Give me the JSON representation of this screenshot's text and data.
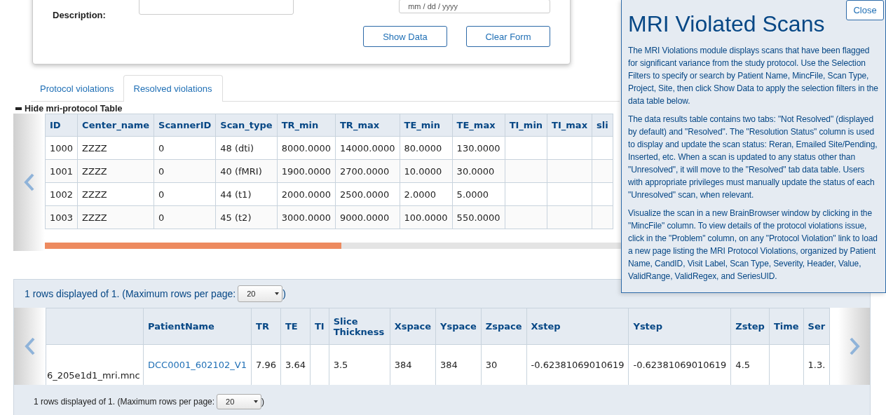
{
  "filter_form": {
    "description_label": "Description:",
    "date_placeholder": "mm / dd / yyyy",
    "buttons": [
      "Show Data",
      "Clear Form"
    ]
  },
  "tabs": [
    {
      "label": "Protocol violations",
      "selected": false
    },
    {
      "label": "Resolved violations",
      "selected": true
    }
  ],
  "protocol_table": {
    "toggle_label": "Hide mri-protocol Table",
    "columns": [
      "ID",
      "Center_name",
      "ScannerID",
      "Scan_type",
      "TR_min",
      "TR_max",
      "TE_min",
      "TE_max",
      "TI_min",
      "TI_max",
      "sli"
    ],
    "rows": [
      [
        "1000",
        "ZZZZ",
        "0",
        "48 (dti)",
        "8000.0000",
        "14000.0000",
        "80.0000",
        "130.0000",
        null,
        null,
        null
      ],
      [
        "1001",
        "ZZZZ",
        "0",
        "40 (fMRI)",
        "1900.0000",
        "2700.0000",
        "10.0000",
        "30.0000",
        null,
        null,
        null
      ],
      [
        "1002",
        "ZZZZ",
        "0",
        "44 (t1)",
        "2000.0000",
        "2500.0000",
        "2.0000",
        "5.0000",
        null,
        null,
        null
      ],
      [
        "1003",
        "ZZZZ",
        "0",
        "45 (t2)",
        "3000.0000",
        "9000.0000",
        "100.0000",
        "550.0000",
        null,
        null,
        null
      ]
    ]
  },
  "results": {
    "summary_text": "1 rows displayed of 1. (Maximum rows per page:",
    "page_size": "20",
    "summary_close": ")",
    "columns": [
      null,
      "PatientName",
      "TR",
      "TE",
      "TI",
      "Slice Thickness",
      "Xspace",
      "Yspace",
      "Zspace",
      "Xstep",
      "Ystep",
      "Zstep",
      "Time",
      "Ser"
    ],
    "rows": [
      [
        {
          "text": "6_205e1d1_mri.mnc",
          "link": false
        },
        {
          "text": "DCC0001_602102_V1",
          "link": true
        },
        {
          "text": "7.96",
          "link": false
        },
        {
          "text": "3.64",
          "link": false
        },
        null,
        {
          "text": "3.5",
          "link": false
        },
        {
          "text": "384",
          "link": false
        },
        {
          "text": "384",
          "link": false
        },
        {
          "text": "30",
          "link": false
        },
        {
          "text": "-0.62381069010619",
          "link": false
        },
        {
          "text": "-0.62381069010619",
          "link": false
        },
        {
          "text": "4.5",
          "link": false
        },
        null,
        {
          "text": "1.3.",
          "link": false
        }
      ]
    ],
    "footer_text": "1 rows displayed of 1. (Maximum rows per page:",
    "footer_page_size": "20",
    "footer_close": ")"
  },
  "help_panel": {
    "title": "MRI Violated Scans",
    "close_label": "Close",
    "paragraphs": [
      "The MRI Violations module displays scans that have been flagged for significant variance from the study protocol. Use the Selection Filters to specify or search by Patient Name, MincFile, Scan Type, Project, Site, then click Show Data to apply the selection filters in the data table below.",
      "The data results table contains two tabs: \"Not Resolved\" (displayed by default) and \"Resolved\". The \"Resolution Status\" column is used to display and update the scan status: Reran, Emailed Site/Pending, Inserted, etc. When a scan is updated to any status other than \"Unresolved\", it will move to the \"Resolved\" tab data table. Users with appropriate privileges must manually update the status of each \"Unresolved\" scan, when relevant.",
      "Visualize the scan in a new BrainBrowser window by clicking in the \"MincFile\" column. To view details of the protocol violations issue, click in the \"Problem\" column, on any \"Protocol Violation\" link to load a new page listing the MRI Protocol Violations, organized by Patient Name, CandID, Visit Label, Scan Type, Severity, Header, Value, ValidRange, ValidRegex, and SeriesUID."
    ]
  }
}
